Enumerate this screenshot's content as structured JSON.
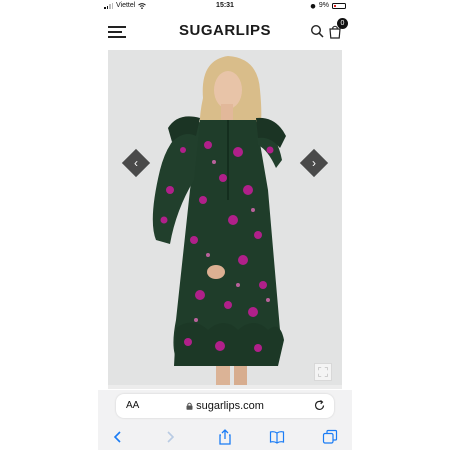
{
  "status_bar": {
    "carrier": "Viettel",
    "time": "15:31",
    "battery": "9%"
  },
  "header": {
    "brand": "SUGARLIPS",
    "cart_count": "0"
  },
  "product": {
    "prev_glyph": "‹",
    "next_glyph": "›"
  },
  "address_bar": {
    "text_size_label": "AA",
    "url": "sugarlips.com"
  },
  "icons": [
    "menu-icon",
    "search-icon",
    "cart-icon",
    "chevron-left-icon",
    "chevron-right-icon",
    "expand-icon",
    "lock-icon",
    "reload-icon",
    "back-icon",
    "forward-icon",
    "share-icon",
    "bookmarks-icon",
    "tabs-icon"
  ],
  "colors": {
    "accent_blue": "#1a7cf5",
    "arrow_bg": "#4a4a4a",
    "dress_green": "#1f3d2a",
    "dress_print": "#b0208a"
  }
}
